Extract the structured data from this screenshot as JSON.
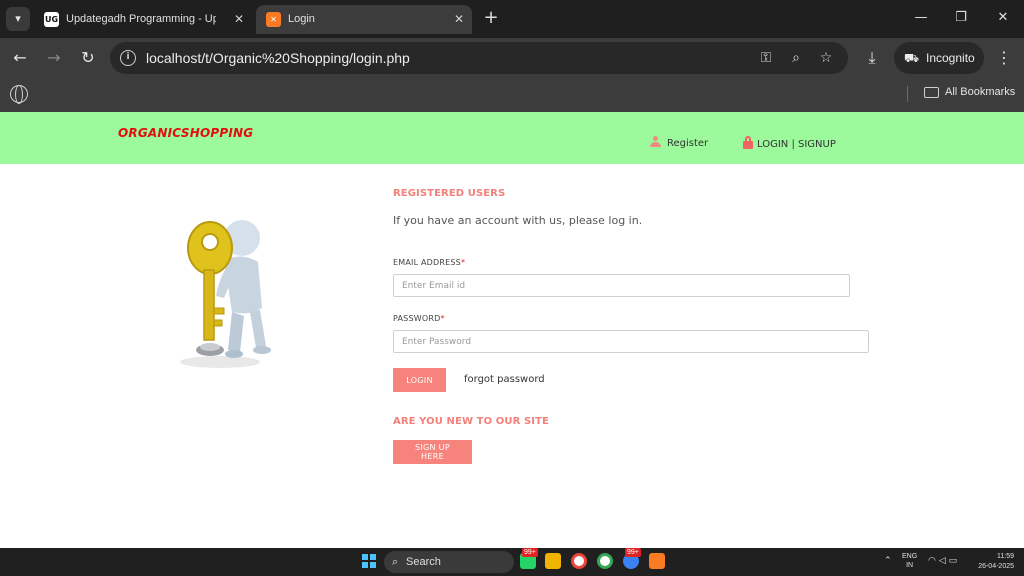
{
  "browser": {
    "tabs": [
      {
        "title": "Updategadh Programming - Upda",
        "favicon": "UG",
        "active": false
      },
      {
        "title": "Login",
        "favicon": "xampp-icon",
        "active": true
      }
    ],
    "new_tab": "+",
    "url": "localhost/t/Organic%20Shopping/login.php",
    "incognito_label": "Incognito",
    "bookmarks_label": "All Bookmarks"
  },
  "site": {
    "brand": "ORGANICSHOPPING",
    "register_label": "Register",
    "login_signup_label": "LOGIN | SIGNUP"
  },
  "login": {
    "registered_title": "REGISTERED USERS",
    "intro": "If you have an account with us, please log in.",
    "email_label": "EMAIL ADDRESS",
    "email_placeholder": "Enter Email id",
    "password_label": "PASSWORD",
    "password_placeholder": "Enter Password",
    "required_mark": "*",
    "login_button": "LOGIN",
    "forgot_password": "forgot password",
    "new_title": "ARE YOU NEW TO OUR SITE",
    "signup_button": "SIGN UP HERE"
  },
  "taskbar": {
    "search_label": "Search",
    "badge_1": "99+",
    "badge_2": "99+",
    "lang_top": "ENG",
    "lang_bottom": "IN",
    "time": "11:59",
    "date": "26-04-2025"
  },
  "colors": {
    "header_green": "#9cf99c",
    "brand_red": "#e01010",
    "accent_salmon": "#f6837c"
  }
}
